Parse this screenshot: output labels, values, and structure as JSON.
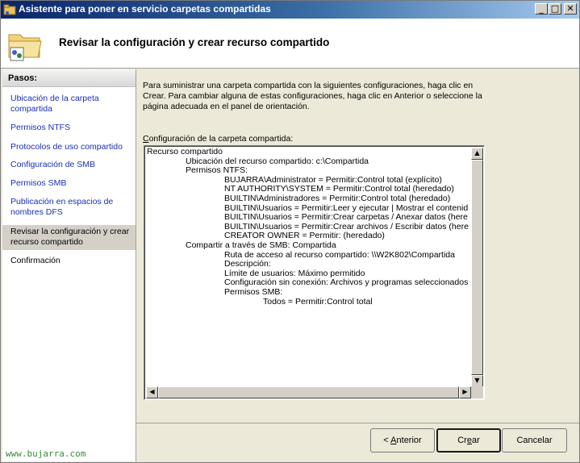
{
  "window": {
    "title": "Asistente para poner en servicio carpetas compartidas",
    "min_label": "_",
    "max_label": "□",
    "close_label": "✕"
  },
  "header": {
    "title": "Revisar la configuración y crear recurso compartido",
    "icon": "shared-folder-icon"
  },
  "sidebar": {
    "title": "Pasos:",
    "items": [
      {
        "label": "Ubicación de la carpeta compartida",
        "state": "link"
      },
      {
        "label": "Permisos NTFS",
        "state": "link"
      },
      {
        "label": "Protocolos de uso compartido",
        "state": "link"
      },
      {
        "label": "Configuración de SMB",
        "state": "link"
      },
      {
        "label": "Permisos SMB",
        "state": "link"
      },
      {
        "label": "Publicación en espacios de nombres DFS",
        "state": "link"
      },
      {
        "label": "Revisar la configuración y crear recurso compartido",
        "state": "current"
      },
      {
        "label": "Confirmación",
        "state": "plain"
      }
    ]
  },
  "main": {
    "intro": "Para suministrar una carpeta compartida con la siguientes configuraciones, haga clic en Crear. Para cambiar alguna de estas configuraciones, haga clic en Anterior o seleccione la página adecuada en el panel de orientación.",
    "config_label_prefix": "C",
    "config_label_rest": "onfiguración de la carpeta compartida:",
    "config_lines": [
      {
        "indent": 0,
        "text": "Recurso compartido"
      },
      {
        "indent": 1,
        "text": "Ubicación del recurso compartido: c:\\Compartida"
      },
      {
        "indent": 1,
        "text": "Permisos NTFS:"
      },
      {
        "indent": 2,
        "text": "BUJARRA\\Administrator = Permitir:Control total (explícito)"
      },
      {
        "indent": 2,
        "text": "NT AUTHORITY\\SYSTEM = Permitir:Control total (heredado)"
      },
      {
        "indent": 2,
        "text": "BUILTIN\\Administradores = Permitir:Control total (heredado)"
      },
      {
        "indent": 2,
        "text": "BUILTIN\\Usuarios = Permitir:Leer y ejecutar | Mostrar el contenid"
      },
      {
        "indent": 2,
        "text": "BUILTIN\\Usuarios = Permitir:Crear carpetas / Anexar datos (here"
      },
      {
        "indent": 2,
        "text": "BUILTIN\\Usuarios = Permitir:Crear archivos / Escribir datos (here"
      },
      {
        "indent": 2,
        "text": "CREATOR OWNER = Permitir: (heredado)"
      },
      {
        "indent": 1,
        "text": "Compartir a través de SMB: Compartida"
      },
      {
        "indent": 2,
        "text": "Ruta de acceso al recurso compartido: \\\\W2K802\\Compartida"
      },
      {
        "indent": 2,
        "text": "Descripción:"
      },
      {
        "indent": 2,
        "text": "Límite de usuarios: Máximo permitido"
      },
      {
        "indent": 2,
        "text": "Configuración sin conexión: Archivos y programas seleccionados"
      },
      {
        "indent": 2,
        "text": "Permisos SMB:"
      },
      {
        "indent": 3,
        "text": "Todos = Permitir:Control total"
      }
    ]
  },
  "buttons": {
    "back_prefix": "< ",
    "back_u": "A",
    "back_rest": "nterior",
    "create_prefix": "Cr",
    "create_u": "e",
    "create_rest": "ar",
    "cancel": "Cancelar"
  },
  "watermark": "www.bujarra.com",
  "colors": {
    "link": "#1a2fb0",
    "selected_step": "#d4d0c8",
    "watermark": "#3a8a3a"
  }
}
